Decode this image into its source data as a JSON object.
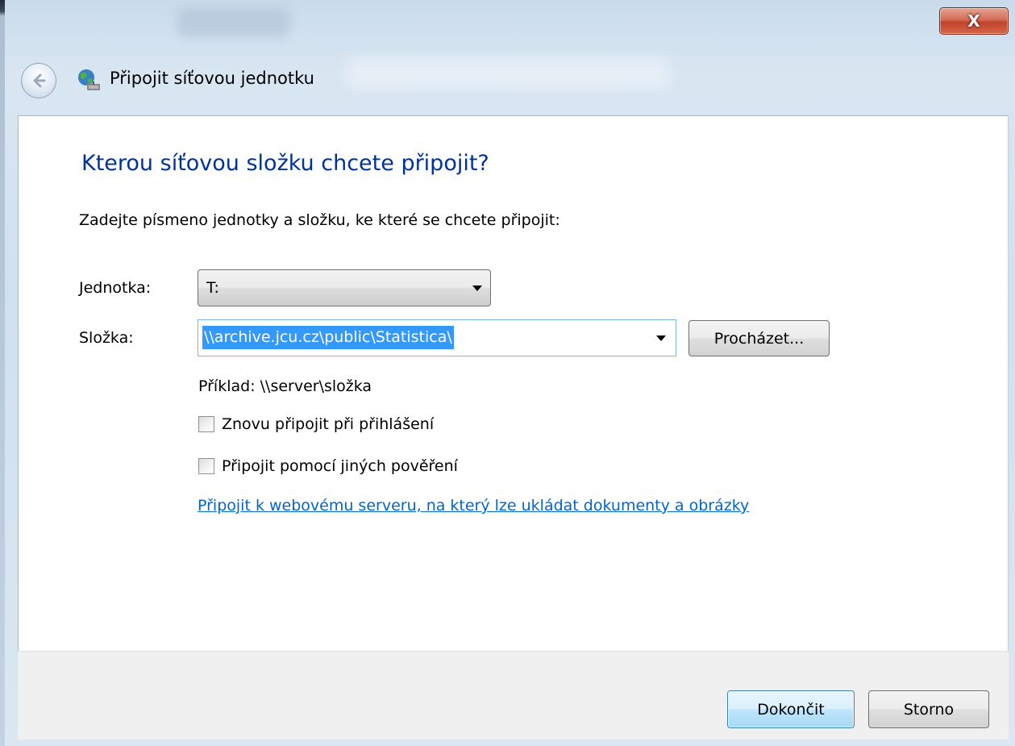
{
  "window": {
    "title": "Připojit síťovou jednotku",
    "close_label": "X",
    "icons": {
      "back": "back-arrow-icon",
      "title": "network-drive-icon",
      "close": "close-icon"
    }
  },
  "content": {
    "heading": "Kterou síťovou složku chcete připojit?",
    "instruction": "Zadejte písmeno jednotky a složku, ke které se chcete připojit:",
    "drive": {
      "label": "Jednotka:",
      "value": "T:"
    },
    "folder": {
      "label": "Složka:",
      "value": "\\\\archive.jcu.cz\\public\\Statistica\\",
      "browse_label": "Procházet..."
    },
    "example": "Příklad: \\\\server\\složka",
    "reconnect": {
      "label": "Znovu připojit při přihlášení",
      "checked": false
    },
    "other_credentials": {
      "label": "Připojit pomocí jiných pověření",
      "checked": false
    },
    "web_link": "Připojit k webovému serveru, na který lze ukládat dokumenty a obrázky"
  },
  "footer": {
    "finish_label": "Dokončit",
    "cancel_label": "Storno"
  },
  "colors": {
    "heading": "#003399",
    "link": "#0066cc",
    "selection": "#3399ff",
    "close_button": "#c2432a"
  }
}
